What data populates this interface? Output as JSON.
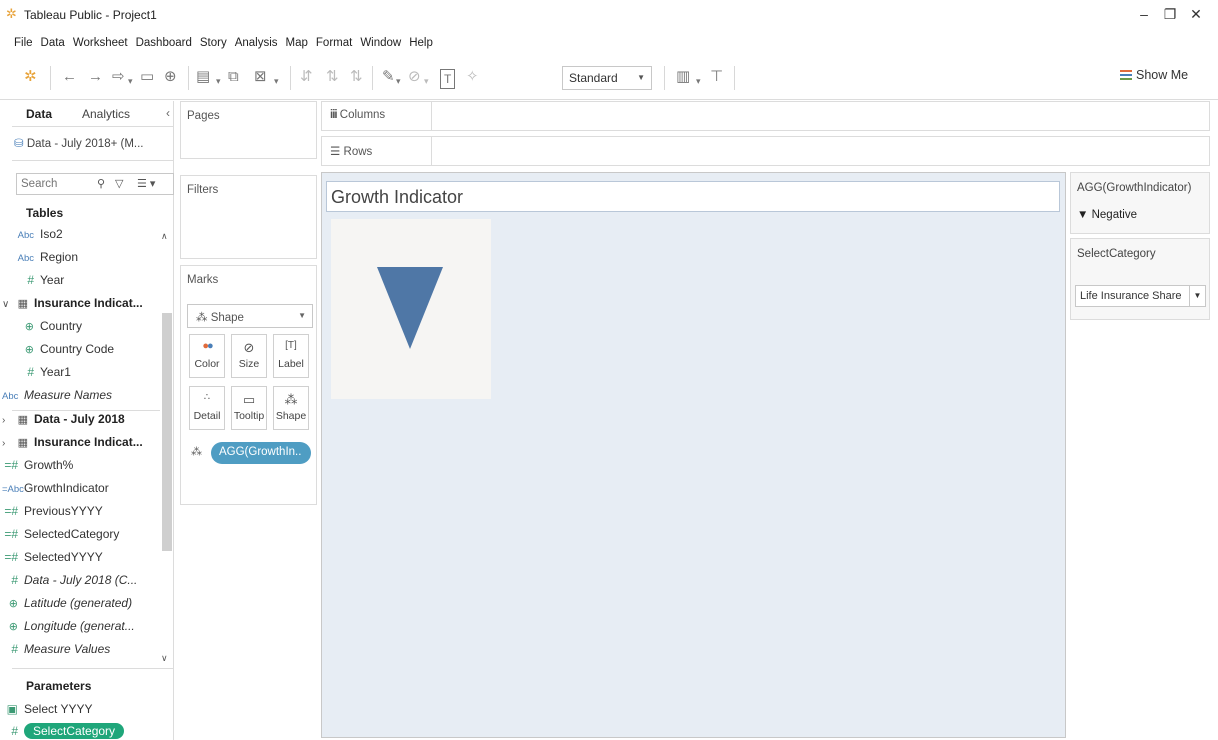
{
  "window": {
    "title": "Tableau Public - Project1"
  },
  "menu": [
    "File",
    "Data",
    "Worksheet",
    "Dashboard",
    "Story",
    "Analysis",
    "Map",
    "Format",
    "Window",
    "Help"
  ],
  "toolbar": {
    "fit_mode": "Standard",
    "show_me": "Show Me"
  },
  "data_pane": {
    "tabs": [
      "Data",
      "Analytics"
    ],
    "datasource": "Data - July 2018+ (M...",
    "search_placeholder": "Search",
    "tables_header": "Tables",
    "fields": [
      {
        "icon": "Abc",
        "label": "Iso2"
      },
      {
        "icon": "Abc",
        "label": "Region"
      },
      {
        "icon": "#",
        "label": "Year"
      },
      {
        "icon": "table",
        "label": "Insurance Indicat..."
      },
      {
        "icon": "globe",
        "label": "Country"
      },
      {
        "icon": "globe",
        "label": "Country Code"
      },
      {
        "icon": "#",
        "label": "Year1"
      },
      {
        "icon": "Abc",
        "label": "Measure Names"
      },
      {
        "icon": "table",
        "label": "Data - July 2018"
      },
      {
        "icon": "table",
        "label": "Insurance Indicat..."
      },
      {
        "icon": "=#",
        "label": "Growth%"
      },
      {
        "icon": "=Abc",
        "label": "GrowthIndicator"
      },
      {
        "icon": "=#",
        "label": "PreviousYYYY"
      },
      {
        "icon": "=#",
        "label": "SelectedCategory"
      },
      {
        "icon": "=#",
        "label": "SelectedYYYY"
      },
      {
        "icon": "#",
        "label": "Data - July 2018 (C..."
      },
      {
        "icon": "globe",
        "label": "Latitude (generated)"
      },
      {
        "icon": "globe",
        "label": "Longitude (generat..."
      },
      {
        "icon": "#",
        "label": "Measure Values"
      }
    ],
    "parameters_header": "Parameters",
    "parameters": [
      {
        "icon": "calendar",
        "label": "Select YYYY"
      },
      {
        "icon": "#",
        "label": "SelectCategory"
      }
    ]
  },
  "shelves": {
    "pages": "Pages",
    "filters": "Filters",
    "marks": "Marks",
    "mark_type": "Shape",
    "mark_buttons": [
      "Color",
      "Size",
      "Label",
      "Detail",
      "Tooltip",
      "Shape"
    ],
    "mark_pill": "AGG(GrowthIn..",
    "columns": "Columns",
    "rows": "Rows"
  },
  "view": {
    "title": "Growth Indicator",
    "mark_color": "#4f77a6"
  },
  "legend": {
    "title": "AGG(GrowthIndicator)",
    "item": "Negative",
    "param_title": "SelectCategory",
    "param_value": "Life Insurance Share"
  }
}
